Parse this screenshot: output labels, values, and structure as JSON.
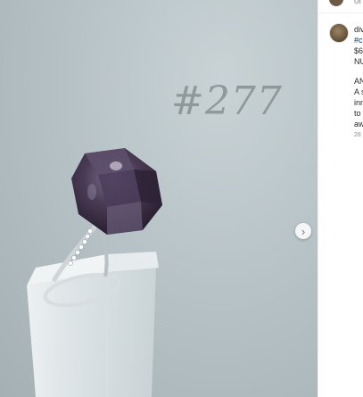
{
  "photo": {
    "caption": "#277",
    "next_arrow": "›"
  },
  "panel": {
    "top_partial": "or",
    "comment_lines": [
      {
        "text": "div",
        "kind": "user"
      },
      {
        "text": "#c",
        "kind": "link"
      },
      {
        "text": "$6",
        "kind": "text"
      },
      {
        "text": "NU",
        "kind": "text"
      },
      {
        "text": "AN",
        "kind": "text"
      },
      {
        "text": "A s",
        "kind": "text"
      },
      {
        "text": "inn",
        "kind": "text"
      },
      {
        "text": "to",
        "kind": "text"
      },
      {
        "text": "aw",
        "kind": "text"
      }
    ],
    "timestamp": "28"
  }
}
